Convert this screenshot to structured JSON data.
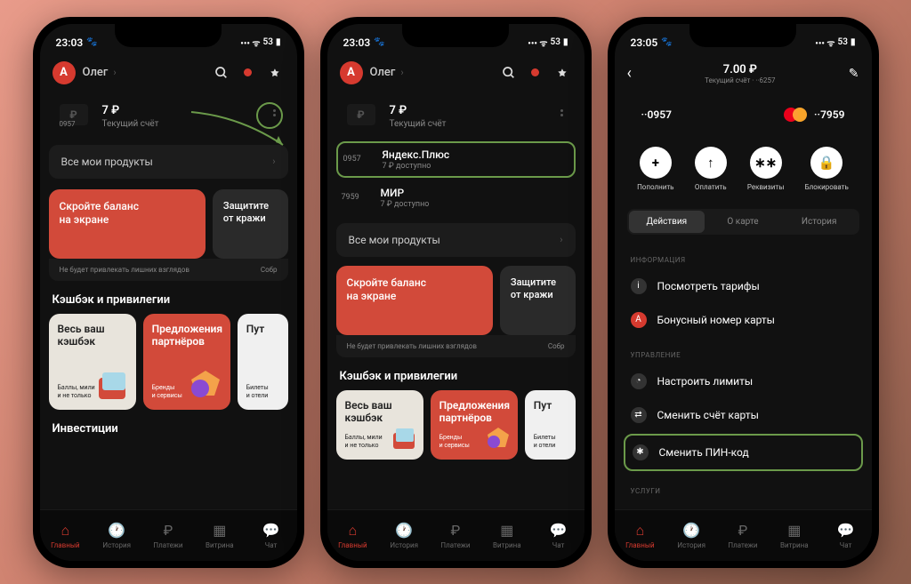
{
  "statusbar": {
    "time1": "23:03",
    "time2": "23:05",
    "paw": "🐾",
    "battery": "53"
  },
  "header": {
    "initial": "А",
    "name": "Олег"
  },
  "account": {
    "balance": "7 ₽",
    "label": "Текущий счёт",
    "num": "0957"
  },
  "cards": [
    {
      "num": "0957",
      "name": "Яндекс.Плюс",
      "sub": "7 ₽ доступно"
    },
    {
      "num": "7959",
      "name": "МИР",
      "sub": "7 ₽ доступно"
    }
  ],
  "allProducts": "Все мои продукты",
  "banner": {
    "redTitle": "Скройте баланс\nна экране",
    "grayTitle": "Защитите\nот кражи",
    "footer1": "Не будет привлекать лишних взглядов",
    "footer2": "Собр"
  },
  "cashback": {
    "section": "Кэшбэк и привилегии",
    "c1": {
      "title": "Весь ваш\nкэшбэк",
      "sub": "Баллы, мили\nи не только"
    },
    "c2": {
      "title": "Предложения\nпартнёров",
      "sub": "Бренды\nи сервисы"
    },
    "c3": {
      "title": "Пут",
      "sub": "Билеты\nи отели"
    }
  },
  "invest": "Инвестиции",
  "tabs": [
    "Главный",
    "История",
    "Платежи",
    "Витрина",
    "Чат"
  ],
  "detail": {
    "balance": "7.00 ₽",
    "sub": "Текущий счёт · ··6257",
    "chip1": "··0957",
    "chip2": "··7959",
    "actions": [
      "Пополнить",
      "Оплатить",
      "Реквизиты",
      "Блокировать"
    ],
    "seg": [
      "Действия",
      "О карте",
      "История"
    ],
    "g1": "ИНФОРМАЦИЯ",
    "i1": "Посмотреть тарифы",
    "i2": "Бонусный номер карты",
    "g2": "УПРАВЛЕНИЕ",
    "i3": "Настроить лимиты",
    "i4": "Сменить счёт карты",
    "i5": "Сменить ПИН-код",
    "g3": "УСЛУГИ"
  }
}
